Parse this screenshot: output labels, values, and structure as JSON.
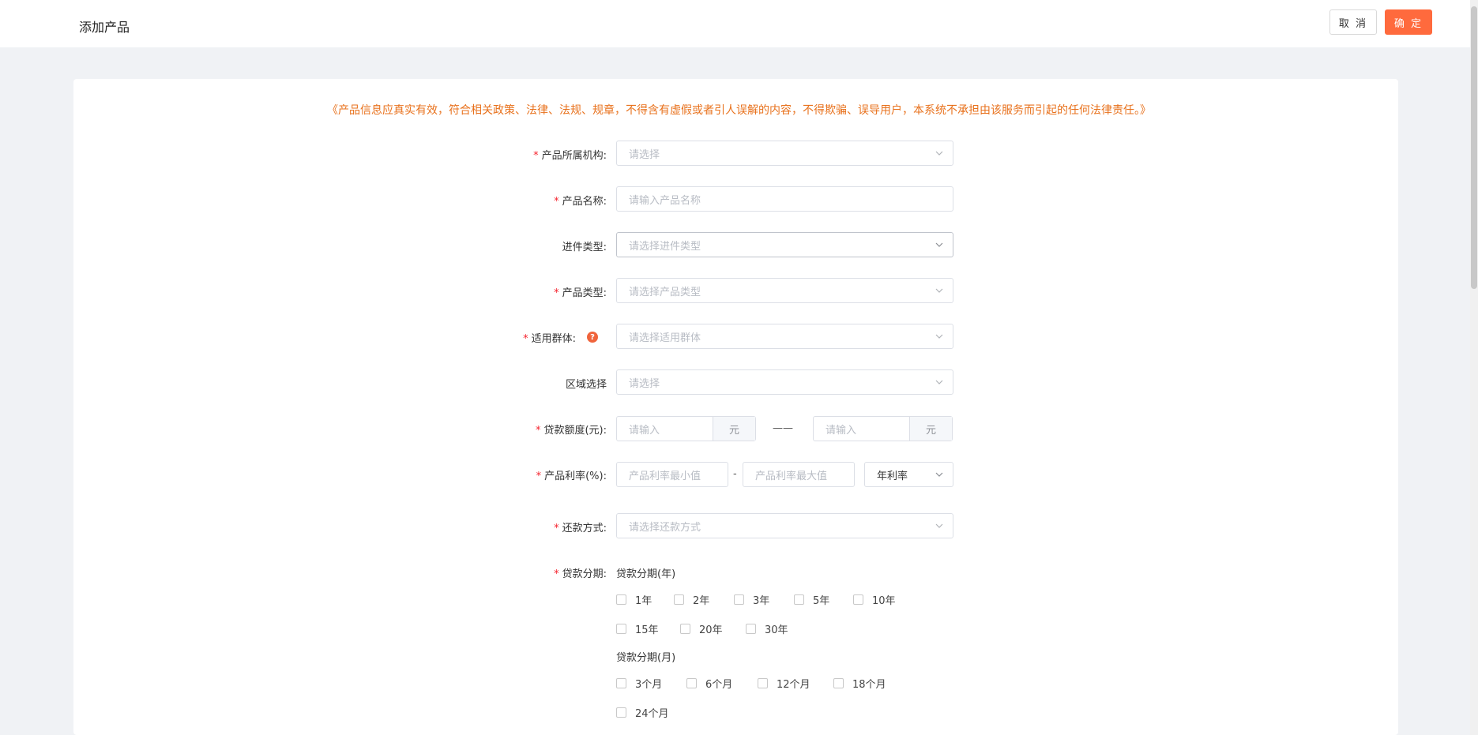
{
  "header": {
    "title": "添加产品",
    "cancel_label": "取 消",
    "ok_label": "确 定"
  },
  "notice": "《产品信息应真实有效，符合相关政策、法律、法规、规章，不得含有虚假或者引人误解的内容，不得欺骗、误导用户，本系统不承担由该服务而引起的任何法律责任。》",
  "form": {
    "org": {
      "label": "产品所属机构:",
      "placeholder": "请选择"
    },
    "name": {
      "label": "产品名称:",
      "placeholder": "请输入产品名称"
    },
    "apply_type": {
      "label": "进件类型:",
      "placeholder": "请选择进件类型"
    },
    "product_type": {
      "label": "产品类型:",
      "placeholder": "请选择产品类型"
    },
    "group": {
      "label": "适用群体:",
      "placeholder": "请选择适用群体",
      "help": "?"
    },
    "region": {
      "label": "区域选择",
      "placeholder": "请选择"
    },
    "amount": {
      "label": "贷款额度(元):",
      "min_placeholder": "请输入",
      "max_placeholder": "请输入",
      "unit": "元",
      "separator": "——"
    },
    "rate": {
      "label": "产品利率(%):",
      "min_placeholder": "产品利率最小值",
      "max_placeholder": "产品利率最大值",
      "separator": "-",
      "rate_type": "年利率"
    },
    "repay": {
      "label": "还款方式:",
      "placeholder": "请选择还款方式"
    },
    "term": {
      "label": "贷款分期:",
      "years_title": "贷款分期(年)",
      "years": [
        "1年",
        "2年",
        "3年",
        "5年",
        "10年",
        "15年",
        "20年",
        "30年"
      ],
      "months_title": "贷款分期(月)",
      "months": [
        "3个月",
        "6个月",
        "12个月",
        "18个月",
        "24个月"
      ]
    },
    "required_mark": "*"
  }
}
